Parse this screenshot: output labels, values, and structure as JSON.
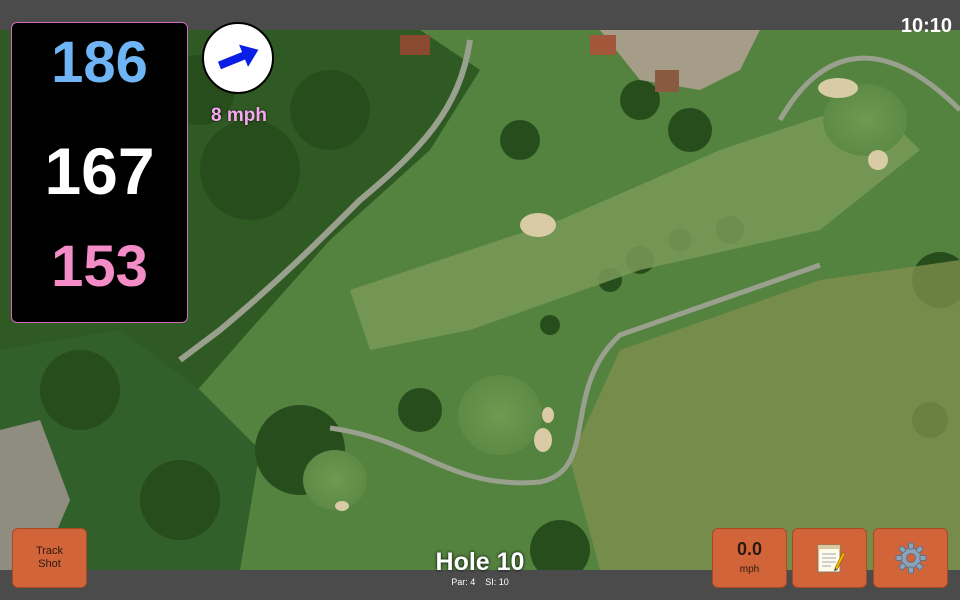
{
  "clock": {
    "time": "10:10"
  },
  "distances": {
    "back": "186",
    "center": "167",
    "front": "153"
  },
  "wind": {
    "speed_label": "8 mph",
    "direction_deg": -22
  },
  "buttons": {
    "track_shot_line1": "Track",
    "track_shot_line2": "Shot",
    "speed_value": "0.0",
    "speed_unit": "mph"
  },
  "hole": {
    "title": "Hole 10",
    "par": "Par: 4",
    "si": "SI: 10"
  },
  "colors": {
    "back": "#6fb4f4",
    "center": "#ffffff",
    "front": "#f48cc8",
    "wind_text": "#f7a8f0",
    "button": "#d2643a",
    "arrow": "#0a1ee6"
  },
  "icons": {
    "wind": "arrow-icon",
    "notes": "notepad-icon",
    "settings": "gear-icon"
  }
}
